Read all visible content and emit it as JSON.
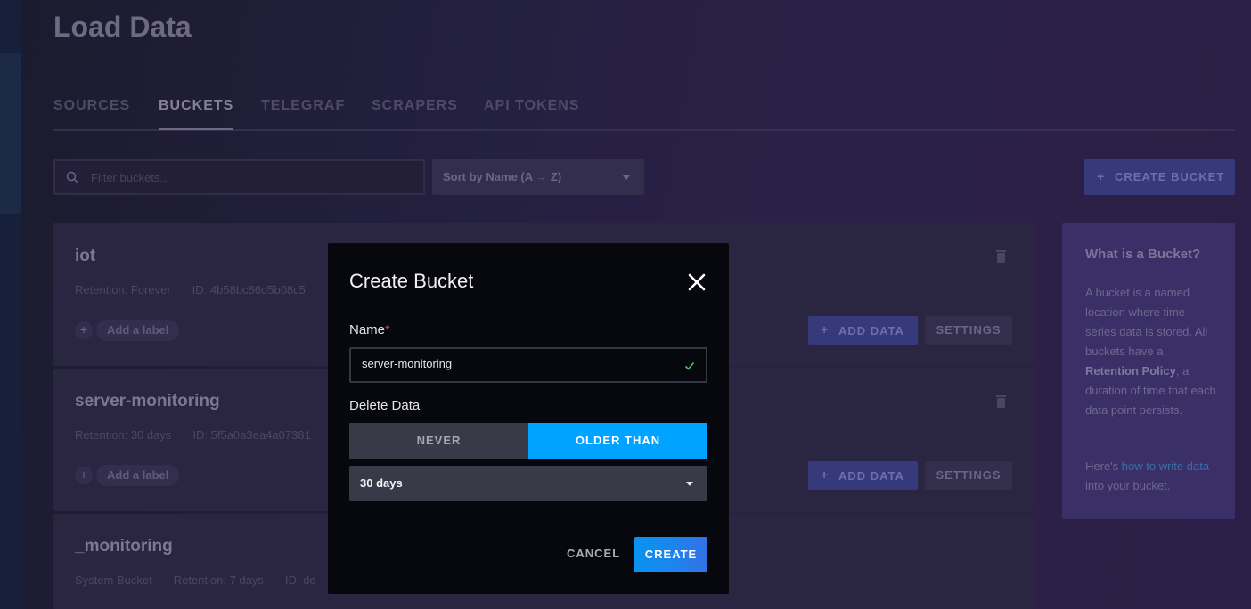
{
  "page": {
    "title": "Load Data",
    "tabs": [
      {
        "label": "SOURCES"
      },
      {
        "label": "BUCKETS"
      },
      {
        "label": "TELEGRAF"
      },
      {
        "label": "SCRAPERS"
      },
      {
        "label": "API TOKENS"
      }
    ],
    "active_tab": "BUCKETS"
  },
  "toolbar": {
    "filter_placeholder": "Filter buckets...",
    "sort_label": "Sort by Name (A → Z)",
    "create_bucket_label": "CREATE BUCKET",
    "create_bucket_icon": "plus-icon"
  },
  "buckets": [
    {
      "name": "iot",
      "retention": "Retention: Forever",
      "id": "ID: 4b58bc86d5b08c5",
      "label_action": "Add a label",
      "add_data": "ADD DATA",
      "settings": "SETTINGS"
    },
    {
      "name": "server-monitoring",
      "retention": "Retention: 30 days",
      "id": "ID: 5f5a0a3ea4a07381",
      "label_action": "Add a label",
      "add_data": "ADD DATA",
      "settings": "SETTINGS"
    },
    {
      "name": "_monitoring",
      "system": "System Bucket",
      "retention": "Retention: 7 days",
      "id": "ID: de"
    }
  ],
  "info_panel": {
    "title": "What is a Bucket?",
    "body_1": "A bucket is a named location where time series data is stored. All buckets have a ",
    "body_bold": "Retention Policy",
    "body_2": ", a duration of time that each data point persists.",
    "p2_prefix": "Here's ",
    "p2_link": "how to write data",
    "p2_suffix": " into your bucket."
  },
  "modal": {
    "title": "Create Bucket",
    "name_label": "Name",
    "name_required_mark": "*",
    "name_value": "server-monitoring",
    "delete_label": "Delete Data",
    "option_never": "NEVER",
    "option_older": "OLDER THAN",
    "selected_option": "OLDER THAN",
    "duration_value": "30 days",
    "cancel_label": "CANCEL",
    "create_label": "CREATE"
  },
  "colors": {
    "accent": "#00a3ff",
    "create_gradient_start": "#0a92f0",
    "create_gradient_end": "#3470e6",
    "required": "#e0454f",
    "valid_check": "#4ac26b"
  }
}
